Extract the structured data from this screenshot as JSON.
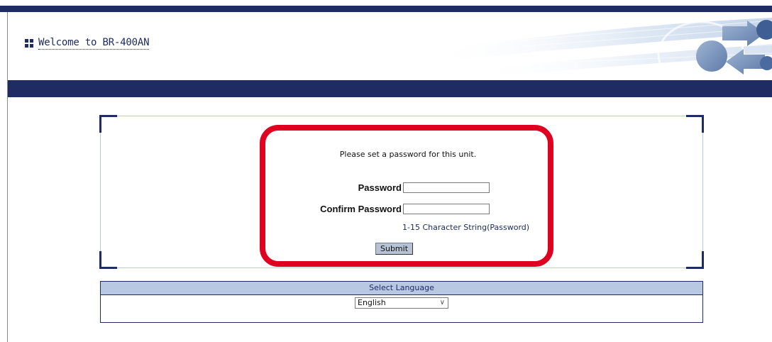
{
  "header": {
    "title": "Welcome to BR-400AN"
  },
  "form": {
    "instruction": "Please set a password for this unit.",
    "password_label": "Password",
    "password_value": "",
    "confirm_label": "Confirm Password",
    "confirm_value": "",
    "hint": "1-15 Character String(Password)",
    "submit_label": "Submit"
  },
  "language": {
    "header": "Select Language",
    "selected": "English"
  },
  "colors": {
    "brand_navy": "#1e2c63",
    "highlight_red": "#e0001f",
    "panel_light_blue": "#b8c8e2"
  },
  "icons": {
    "welcome": "grid-bullet-icon",
    "header_logo": "network-arrows-logo",
    "select_arrow": "chevron-down-icon"
  }
}
